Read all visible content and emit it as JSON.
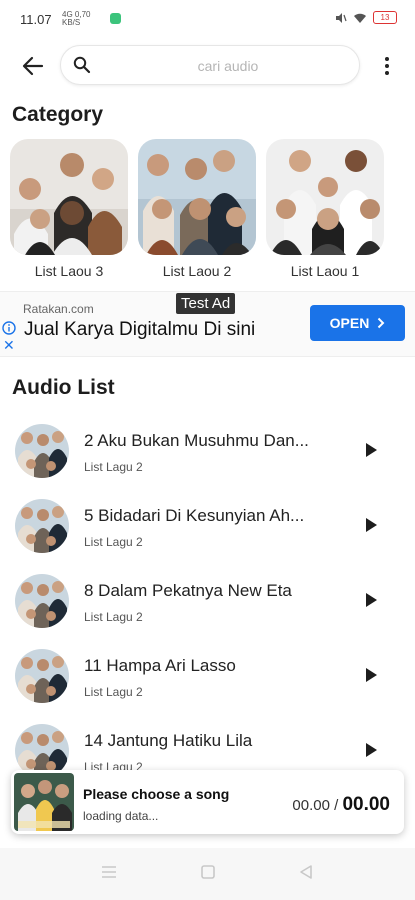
{
  "status_bar": {
    "time": "11.07",
    "network_text": "4G  0,70 KB/S",
    "battery": "13",
    "icons": [
      "app-notification-icon",
      "mute-icon",
      "wifi-icon",
      "battery-icon"
    ]
  },
  "search": {
    "placeholder": "cari audio"
  },
  "category": {
    "title": "Category",
    "items": [
      {
        "label": "List Laou 3"
      },
      {
        "label": "List Laou 2"
      },
      {
        "label": "List Laou 1"
      }
    ]
  },
  "ad": {
    "domain": "Ratakan.com",
    "badge": "Test Ad",
    "headline": "Jual Karya Digitalmu Di sini",
    "button": "OPEN",
    "accent_color": "#1a73e8"
  },
  "audio_list": {
    "title": "Audio List",
    "items": [
      {
        "title": "2 Aku Bukan Musuhmu Dan...",
        "subtitle": "List Lagu 2"
      },
      {
        "title": "5 Bidadari Di Kesunyian Ah...",
        "subtitle": "List Lagu 2"
      },
      {
        "title": "8 Dalam Pekatnya New Eta",
        "subtitle": "List Lagu 2"
      },
      {
        "title": "11 Hampa Ari Lasso",
        "subtitle": "List Lagu 2"
      },
      {
        "title": "14 Jantung Hatiku Lila",
        "subtitle": "List Lagu 2"
      }
    ]
  },
  "player": {
    "title": "Please choose a song",
    "status": "loading data...",
    "current_time": "00.00",
    "separator": "/",
    "total_time": "00.00"
  }
}
